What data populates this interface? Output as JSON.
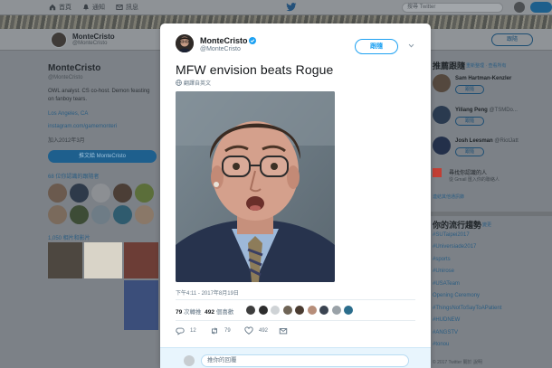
{
  "nav": {
    "items": [
      {
        "label": "首頁",
        "icon": "home-icon"
      },
      {
        "label": "通知",
        "icon": "bell-icon"
      },
      {
        "label": "訊息",
        "icon": "envelope-icon"
      }
    ],
    "search_placeholder": "搜尋 Twitter"
  },
  "background_profile": {
    "name": "MonteCristo",
    "handle": "@MonteCristo",
    "bio": "OWL analyst. CS co-host. Demon feasting on fanboy tears.",
    "location": "Los Angeles, CA",
    "website": "instagram.com/gamemonteri",
    "joined": "加入2012年3月",
    "tweet_to_button": "推文給 MonteCristo",
    "follow_button": "跟隨",
    "followers_you_know": "68 位你認識的跟隨者",
    "media_link": "1,050 相片和影片"
  },
  "who_to_follow": {
    "title": "推薦跟隨",
    "links": "· 重新整理 · 查看所有",
    "accounts": [
      {
        "name": "Sam Hartman-Kenzler",
        "handle": "",
        "follow": "跟隨"
      },
      {
        "name": "Yiliang Peng",
        "handle": "@TSMDo...",
        "follow": "跟隨"
      },
      {
        "name": "Josh Leesman",
        "handle": "@RiotJatt",
        "follow": "跟隨"
      }
    ],
    "find_people_title": "尋找你認識的人",
    "find_people_sub": "從 Gmail 匯入你的聯絡人",
    "connect_more": "連結其他通訊錄"
  },
  "trends": {
    "title": "你的流行趨勢",
    "change": "· 變更",
    "items": [
      "#SUTaipei2017",
      "#Universiade2017",
      "#sports",
      "#Unirose",
      "#USATeam",
      "Opening Ceremony",
      "#ThingsNotToSayToAPatient",
      "#HUDNEW",
      "#ANGSTV",
      "#tonou"
    ]
  },
  "background_footer": "© 2017 Twitter  關於  說明",
  "tweet": {
    "author_name": "MonteCristo",
    "author_handle": "@MonteCristo",
    "follow_label": "跟隨",
    "text": "MFW envision beats Rogue",
    "translate_label": "翻譯自英文",
    "timestamp": "下午4:11 - 2017年8月19日",
    "retweets_count": "79",
    "retweets_label": "次轉推",
    "likes_count": "492",
    "likes_label": "個喜歡",
    "reply_count": "12",
    "retweet_action_count": "79",
    "like_action_count": "492",
    "reply_placeholder": "推你的回覆"
  },
  "colors": {
    "accent": "#1da1f2",
    "text": "#14171a",
    "muted": "#657786",
    "verified": "#1da1f2"
  }
}
